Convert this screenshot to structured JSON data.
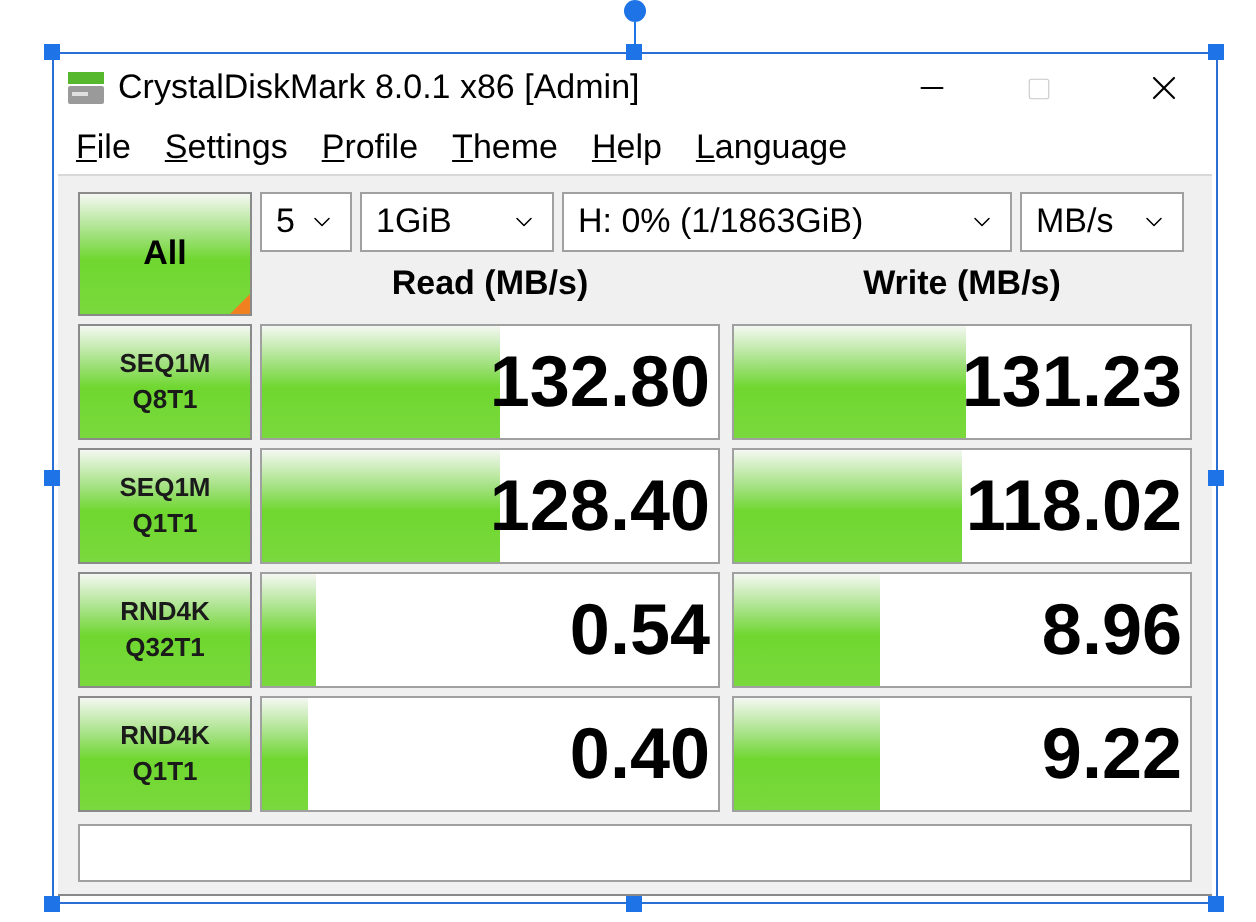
{
  "window": {
    "title": "CrystalDiskMark 8.0.1 x86 [Admin]"
  },
  "menu": [
    "File",
    "Settings",
    "Profile",
    "Theme",
    "Help",
    "Language"
  ],
  "all_button": "All",
  "selectors": [
    {
      "value": "5"
    },
    {
      "value": "1GiB"
    },
    {
      "value": "H: 0% (1/1863GiB)"
    },
    {
      "value": "MB/s"
    }
  ],
  "columns": [
    "Read (MB/s)",
    "Write (MB/s)"
  ],
  "rows": [
    {
      "test": [
        "SEQ1M",
        "Q8T1"
      ],
      "read": {
        "value": "132.80",
        "level": 0.52
      },
      "write": {
        "value": "131.23",
        "level": 0.51
      }
    },
    {
      "test": [
        "SEQ1M",
        "Q1T1"
      ],
      "read": {
        "value": "128.40",
        "level": 0.52
      },
      "write": {
        "value": "118.02",
        "level": 0.5
      }
    },
    {
      "test": [
        "RND4K",
        "Q32T1"
      ],
      "read": {
        "value": "0.54",
        "level": 0.12
      },
      "write": {
        "value": "8.96",
        "level": 0.32
      }
    },
    {
      "test": [
        "RND4K",
        "Q1T1"
      ],
      "read": {
        "value": "0.40",
        "level": 0.1
      },
      "write": {
        "value": "9.22",
        "level": 0.32
      }
    }
  ]
}
